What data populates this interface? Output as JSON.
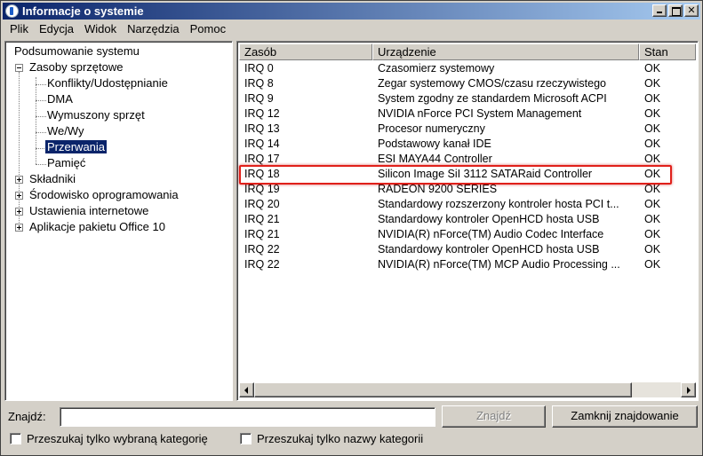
{
  "window": {
    "title": "Informacje o systemie",
    "close_glyph": "✕"
  },
  "menu": [
    "Plik",
    "Edycja",
    "Widok",
    "Narzędzia",
    "Pomoc"
  ],
  "tree": {
    "items": [
      {
        "label": "Podsumowanie systemu"
      },
      {
        "label": "Zasoby sprzętowe"
      },
      {
        "label": "Konflikty/Udostępnianie"
      },
      {
        "label": "DMA"
      },
      {
        "label": "Wymuszony sprzęt"
      },
      {
        "label": "We/Wy"
      },
      {
        "label": "Przerwania"
      },
      {
        "label": "Pamięć"
      },
      {
        "label": "Składniki"
      },
      {
        "label": "Środowisko oprogramowania"
      },
      {
        "label": "Ustawienia internetowe"
      },
      {
        "label": "Aplikacje pakietu Office 10"
      }
    ]
  },
  "table": {
    "columns": [
      "Zasób",
      "Urządzenie",
      "Stan"
    ],
    "rows": [
      [
        "IRQ 0",
        "Czasomierz systemowy",
        "OK"
      ],
      [
        "IRQ 8",
        "Zegar systemowy CMOS/czasu rzeczywistego",
        "OK"
      ],
      [
        "IRQ 9",
        "System zgodny ze standardem Microsoft ACPI",
        "OK"
      ],
      [
        "IRQ 12",
        "NVIDIA nForce PCI System Management",
        "OK"
      ],
      [
        "IRQ 13",
        "Procesor numeryczny",
        "OK"
      ],
      [
        "IRQ 14",
        "Podstawowy kanał IDE",
        "OK"
      ],
      [
        "IRQ 17",
        "ESI MAYA44 Controller",
        "OK"
      ],
      [
        "IRQ 18",
        "Silicon Image SiI 3112 SATARaid Controller",
        "OK"
      ],
      [
        "IRQ 19",
        "RADEON 9200 SERIES",
        "OK"
      ],
      [
        "IRQ 20",
        "Standardowy rozszerzony kontroler hosta PCI t...",
        "OK"
      ],
      [
        "IRQ 21",
        "Standardowy kontroler OpenHCD hosta USB",
        "OK"
      ],
      [
        "IRQ 21",
        "NVIDIA(R) nForce(TM) Audio Codec Interface",
        "OK"
      ],
      [
        "IRQ 22",
        "Standardowy kontroler OpenHCD hosta USB",
        "OK"
      ],
      [
        "IRQ 22",
        "NVIDIA(R) nForce(TM) MCP Audio Processing ...",
        "OK"
      ]
    ]
  },
  "find": {
    "label": "Znajdź:",
    "value": "",
    "find_button": "Znajdź",
    "close_find_button": "Zamknij znajdowanie",
    "check_selected_category": "Przeszukaj tylko wybraną kategorię",
    "check_category_names": "Przeszukaj tylko nazwy kategorii"
  },
  "colors": {
    "selection": "#0a246a",
    "highlight_box": "#e0201a"
  }
}
